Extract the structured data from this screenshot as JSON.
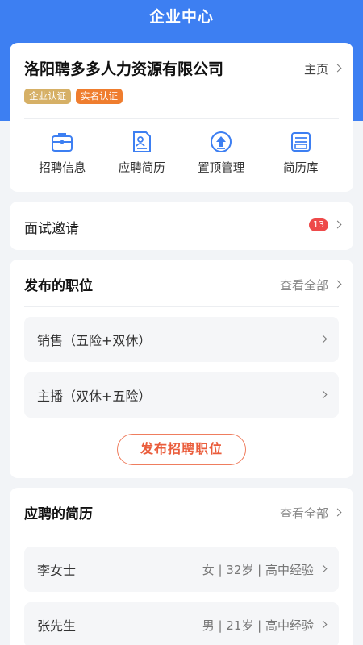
{
  "header": {
    "title": "企业中心"
  },
  "company": {
    "name": "洛阳聘多多人力资源有限公司",
    "home_label": "主页",
    "badges": [
      "企业认证",
      "实名认证"
    ]
  },
  "actions": [
    {
      "label": "招聘信息",
      "icon": "briefcase-icon"
    },
    {
      "label": "应聘简历",
      "icon": "resume-icon"
    },
    {
      "label": "置顶管理",
      "icon": "pin-top-icon"
    },
    {
      "label": "简历库",
      "icon": "resume-library-icon"
    }
  ],
  "interview": {
    "label": "面试邀请",
    "count": "13"
  },
  "jobs": {
    "title": "发布的职位",
    "see_all": "查看全部",
    "items": [
      "销售（五险+双休）",
      "主播（双休+五险）"
    ],
    "post_button": "发布招聘职位"
  },
  "resumes": {
    "title": "应聘的简历",
    "see_all": "查看全部",
    "items": [
      {
        "name": "李女士",
        "info": "女 | 32岁 | 高中经验"
      },
      {
        "name": "张先生",
        "info": "男 | 21岁 | 高中经验"
      }
    ]
  },
  "colors": {
    "primary": "#3d7ff2",
    "enterprise_badge": "#d6b066",
    "realname_badge": "#ef7d2e",
    "count_badge": "#ee4a4a",
    "post_button": "#ea5d3c"
  }
}
